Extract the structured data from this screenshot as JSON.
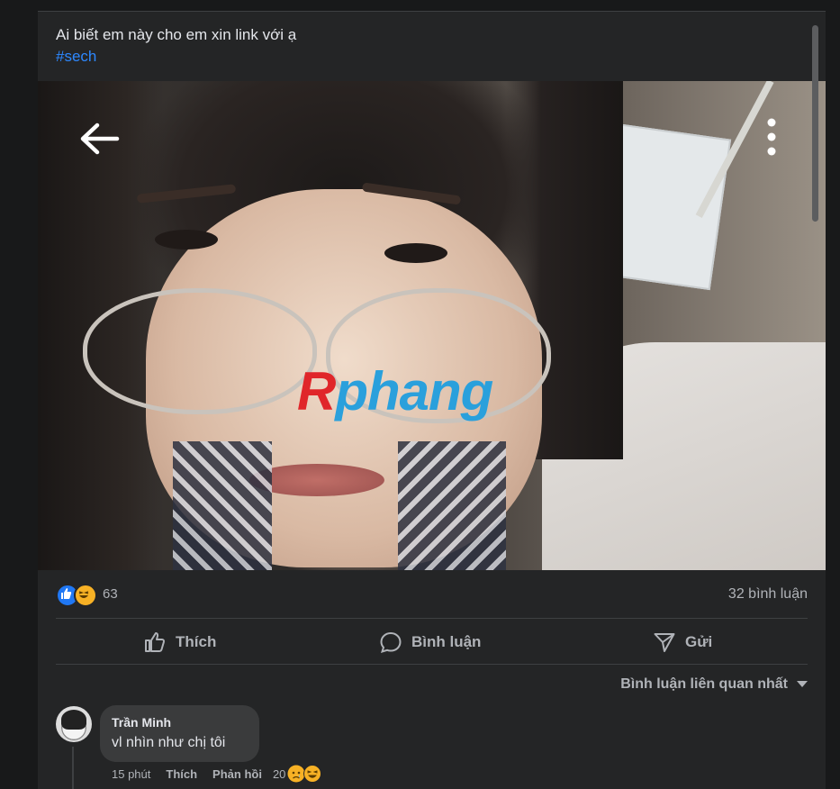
{
  "post": {
    "caption": "Ai biết em này cho em xin link với ạ",
    "hashtag": "#sech",
    "watermark_part1": "R",
    "watermark_part2": "phang"
  },
  "stats": {
    "reaction_count": "63",
    "reaction_icons": [
      "like-icon",
      "haha-icon"
    ],
    "comment_count": "32 bình luận"
  },
  "actions": {
    "like": "Thích",
    "comment": "Bình luận",
    "send": "Gửi"
  },
  "comments_sort": {
    "label": "Bình luận liên quan nhất"
  },
  "comment": {
    "author": "Trần Minh",
    "text": "vl nhìn như chị tôi",
    "time": "15 phút",
    "like": "Thích",
    "reply": "Phản hồi",
    "reaction_count": "20",
    "reaction_icons": [
      "sad-icon",
      "haha-icon"
    ]
  },
  "colors": {
    "background": "#18191a",
    "card": "#242526",
    "link": "#2d88ff",
    "like_blue": "#2078f4",
    "haha_yellow": "#f7b125",
    "watermark_red": "#e0262a",
    "watermark_blue": "#2aa0dc"
  }
}
